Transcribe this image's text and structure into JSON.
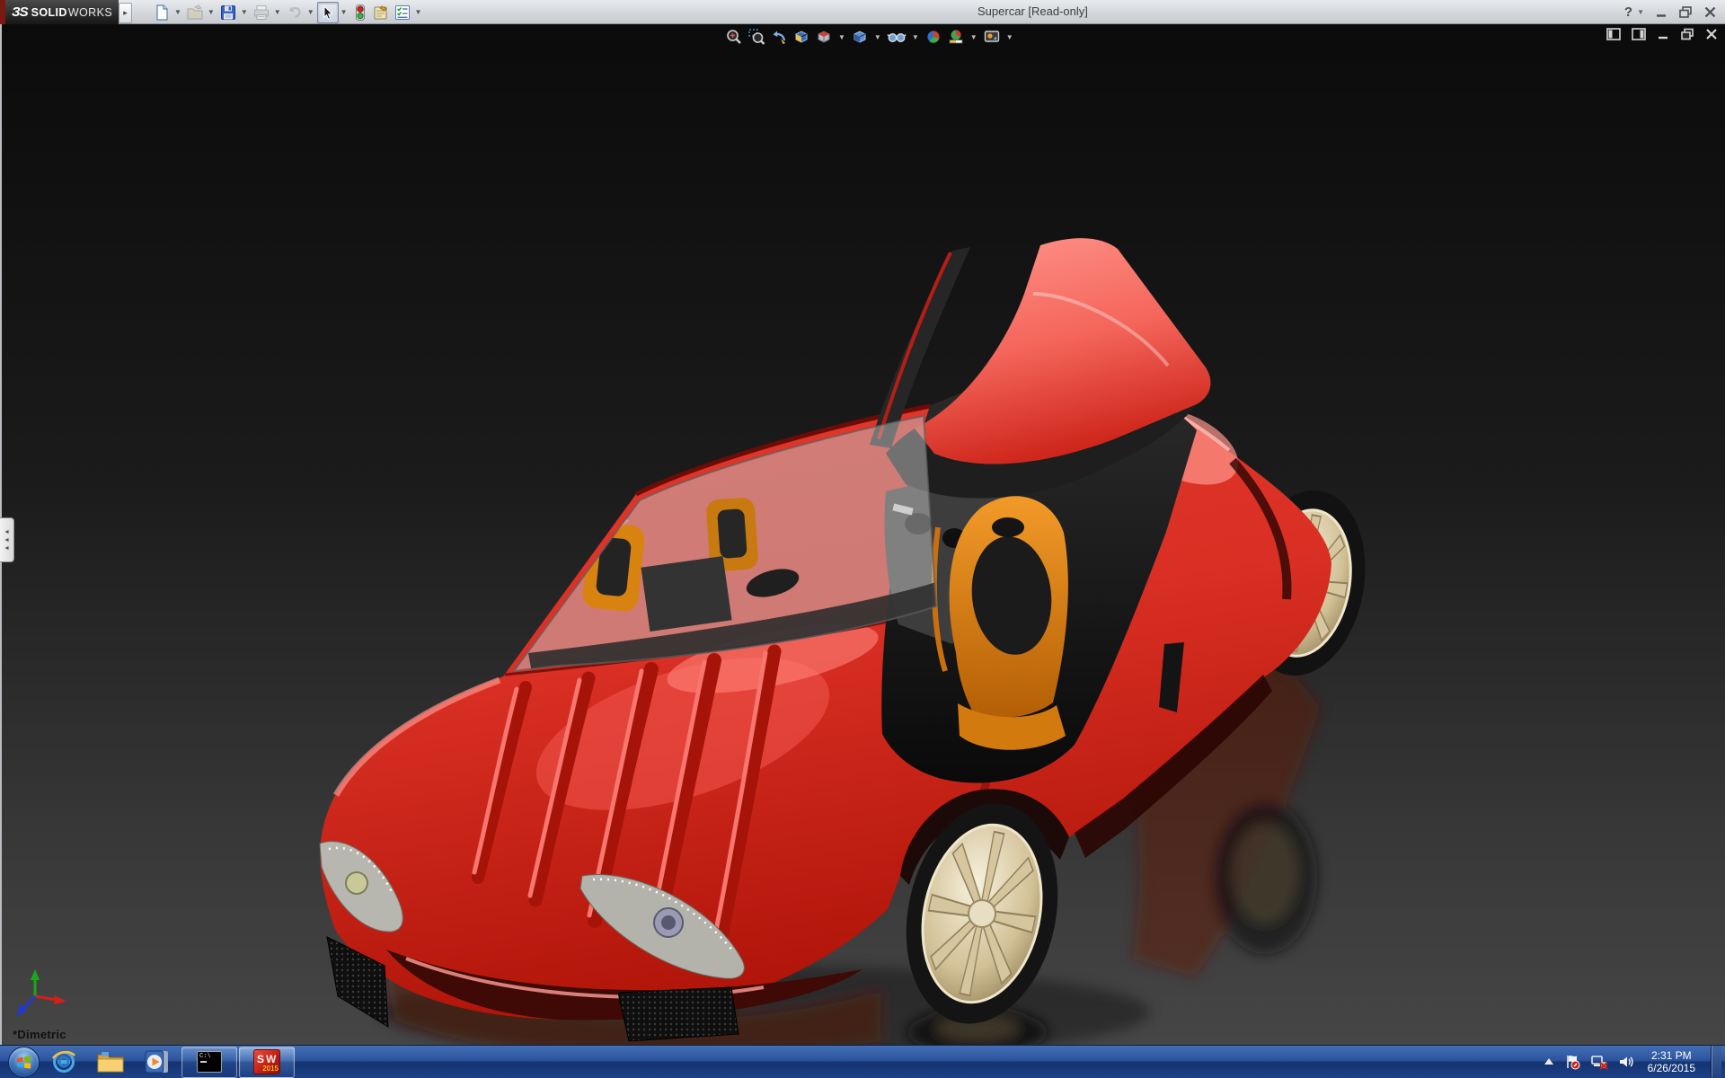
{
  "window": {
    "title": "Supercar [Read-only]",
    "brand_mark": "ЗS",
    "brand_solid": "SOLID",
    "brand_works": "WORKS",
    "help_glyph": "?",
    "flyout_glyph": "▸"
  },
  "main_toolbar": {
    "items": [
      {
        "name": "new",
        "tooltip": "New"
      },
      {
        "name": "open",
        "tooltip": "Open"
      },
      {
        "name": "save",
        "tooltip": "Save"
      },
      {
        "name": "print",
        "tooltip": "Print"
      },
      {
        "name": "undo",
        "tooltip": "Undo"
      },
      {
        "name": "select",
        "tooltip": "Select"
      },
      {
        "name": "rebuild",
        "tooltip": "Rebuild"
      },
      {
        "name": "file-properties",
        "tooltip": "File Properties"
      },
      {
        "name": "options",
        "tooltip": "Options"
      }
    ]
  },
  "headsup_toolbar": {
    "items": [
      {
        "name": "zoom-to-fit",
        "tooltip": "Zoom to Fit"
      },
      {
        "name": "zoom-to-area",
        "tooltip": "Zoom to Area"
      },
      {
        "name": "previous-view",
        "tooltip": "Previous View"
      },
      {
        "name": "section-view",
        "tooltip": "Section View"
      },
      {
        "name": "view-orientation",
        "tooltip": "View Orientation"
      },
      {
        "name": "display-style",
        "tooltip": "Display Style"
      },
      {
        "name": "hide-show-items",
        "tooltip": "Hide/Show Items"
      },
      {
        "name": "edit-appearance",
        "tooltip": "Edit Appearance"
      },
      {
        "name": "apply-scene",
        "tooltip": "Apply Scene"
      },
      {
        "name": "view-settings",
        "tooltip": "View Settings"
      }
    ]
  },
  "document_controls": {
    "items": [
      {
        "name": "show-feature-pane",
        "tooltip": "Show FeatureManager"
      },
      {
        "name": "show-display-pane",
        "tooltip": "Show Display Pane"
      },
      {
        "name": "minimize-document",
        "tooltip": "Minimize"
      },
      {
        "name": "restore-document",
        "tooltip": "Restore"
      },
      {
        "name": "close-document",
        "tooltip": "Close"
      }
    ]
  },
  "viewport": {
    "view_label": "*Dimetric",
    "model": "red supercar with open gullwing door"
  },
  "taskbar": {
    "start_tooltip": "Start",
    "items": [
      {
        "name": "internet-explorer",
        "tooltip": "Internet Explorer"
      },
      {
        "name": "windows-explorer",
        "tooltip": "Windows Explorer"
      },
      {
        "name": "windows-media-player",
        "tooltip": "Windows Media Player"
      },
      {
        "name": "command-prompt",
        "tooltip": "Command Prompt",
        "label": "C:\\"
      },
      {
        "name": "solidworks-2015",
        "tooltip": "SOLIDWORKS 2015",
        "badge_s": "S",
        "badge_w": "W",
        "badge_year": "2015"
      }
    ],
    "tray": {
      "icons": [
        "show-hidden-icons",
        "action-center",
        "network-error",
        "volume"
      ],
      "time": "2:31 PM",
      "date": "6/26/2015"
    }
  },
  "colors": {
    "body_red": "#d6352c",
    "seat_orange": "#d8820f",
    "taskbar_blue": "#2b549e",
    "viewport_floor": "#424242"
  }
}
